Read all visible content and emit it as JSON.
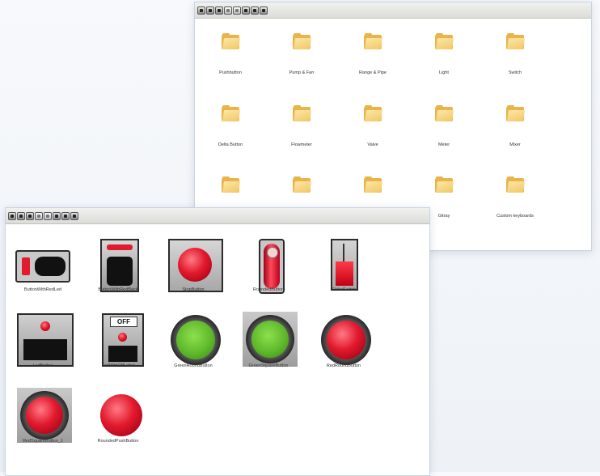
{
  "back_window": {
    "toolbar_icons": [
      "printer-icon",
      "save-icon",
      "copy-icon",
      "paste-icon",
      "properties-icon",
      "grid-icon",
      "print-preview-icon",
      "refresh-icon"
    ],
    "folders": [
      {
        "label": "Pushbutton"
      },
      {
        "label": "Pump & Fan"
      },
      {
        "label": "Range & Pipe"
      },
      {
        "label": "Light"
      },
      {
        "label": "Switch"
      },
      {
        "label": "Delta Button"
      },
      {
        "label": "Flowmeter"
      },
      {
        "label": "Valve"
      },
      {
        "label": "Meter"
      },
      {
        "label": "Mixer"
      },
      {
        "label": ""
      },
      {
        "label": ""
      },
      {
        "label": ""
      },
      {
        "label": "Gitray"
      },
      {
        "label": "Custom keyboards"
      }
    ]
  },
  "front_window": {
    "toolbar_icons": [
      "printer-icon",
      "save-icon",
      "copy-icon",
      "paste-icon",
      "properties-icon",
      "grid-icon",
      "print-preview-icon",
      "refresh-icon"
    ],
    "controls": [
      {
        "label": "ButtonWithRedLed",
        "type": "toggle-red-black"
      },
      {
        "label": "ButtonWithRedBack",
        "type": "red-black-stack"
      },
      {
        "label": "StopButton",
        "type": "red-mushroom-square"
      },
      {
        "label": "RoundedButton",
        "type": "red-capsule"
      },
      {
        "label": "SliderSwitch",
        "type": "slider-switch"
      },
      {
        "label": "LedButton",
        "type": "led-box"
      },
      {
        "label": "LedWithOffLabel",
        "type": "off-led-box",
        "off_text": "OFF"
      },
      {
        "label": "GreenRoundButton",
        "type": "green-round"
      },
      {
        "label": "GreenSquareButton",
        "type": "green-square"
      },
      {
        "label": "RedRoundButton",
        "type": "red-round"
      },
      {
        "label": "RedSquareButton_1",
        "type": "red-square"
      },
      {
        "label": "RoundedPushButton",
        "type": "red-flat"
      }
    ]
  }
}
